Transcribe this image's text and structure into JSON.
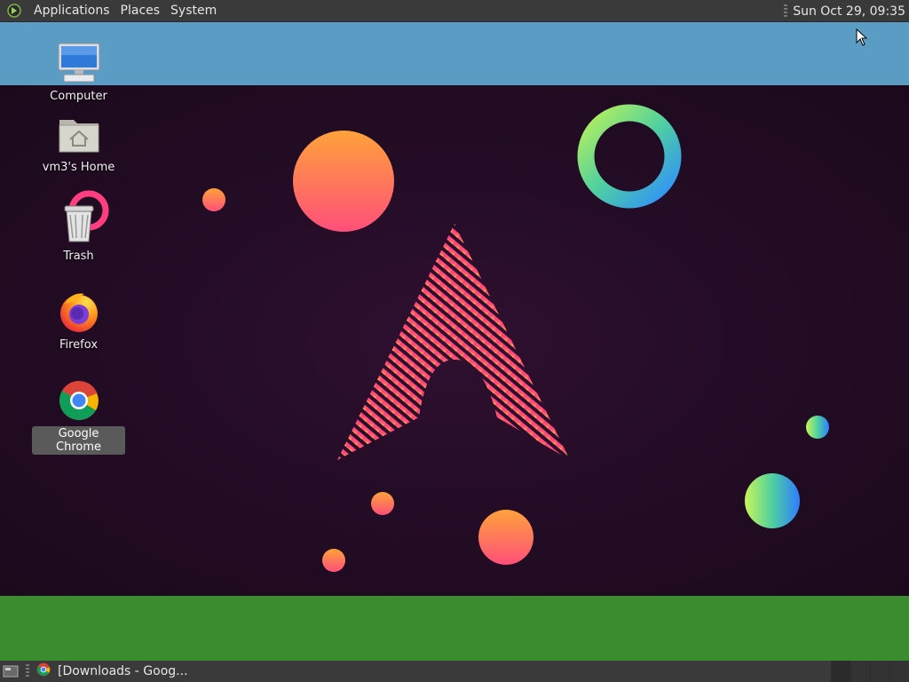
{
  "top_panel": {
    "menus": [
      "Applications",
      "Places",
      "System"
    ],
    "clock": "Sun Oct 29, 09:35"
  },
  "desktop": {
    "icons": [
      {
        "label": "Computer",
        "icon": "computer-icon"
      },
      {
        "label": "vm3's Home",
        "icon": "home-folder-icon"
      },
      {
        "label": "Trash",
        "icon": "trash-icon"
      },
      {
        "label": "Firefox",
        "icon": "firefox-icon"
      },
      {
        "label": "Google Chrome",
        "icon": "chrome-icon",
        "selected": true
      }
    ]
  },
  "bottom_panel": {
    "tasks": [
      {
        "label": "[Downloads - Goog...",
        "icon": "chrome-icon"
      }
    ],
    "workspace_count": 4
  },
  "colors": {
    "panel": "#3a3a3a",
    "wallpaper_top": "#5b9cc5",
    "wallpaper_bottom": "#3b8c2e",
    "wallpaper_center": "#240c26"
  }
}
